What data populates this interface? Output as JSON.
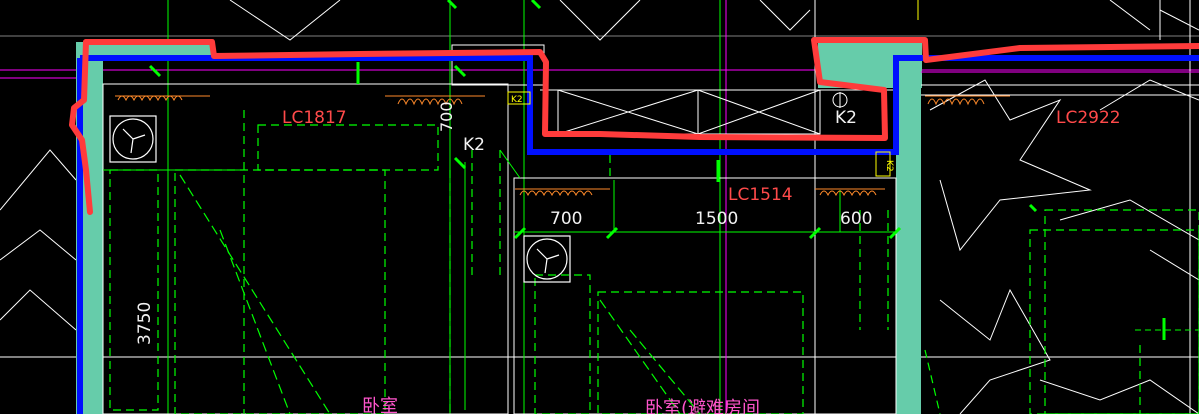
{
  "labels": {
    "window_lc1817": "LC1817",
    "window_lc1514": "LC1514",
    "window_lc2922": "LC2922",
    "k2_left": "K2",
    "k2_right": "K2",
    "k2_tag_top": "K2",
    "k2_tag_side": "K2",
    "dim_700_vertical": "700",
    "dim_700": "700",
    "dim_1500": "1500",
    "dim_600": "600",
    "dim_3750": "3750",
    "room_bedroom": "卧室",
    "room_bedroom_shelter": "卧室(避难房间"
  },
  "colors": {
    "background": "#000000",
    "wall_fill": "#66ccaa",
    "annotation_red": "#ff3b3b",
    "blue_line": "#0010ff",
    "cad_green": "#00ff00",
    "cad_magenta": "#ff00ff",
    "cad_white": "#ffffff",
    "cad_yellow": "#ffff00",
    "window_red_text": "#ff4a4a"
  }
}
